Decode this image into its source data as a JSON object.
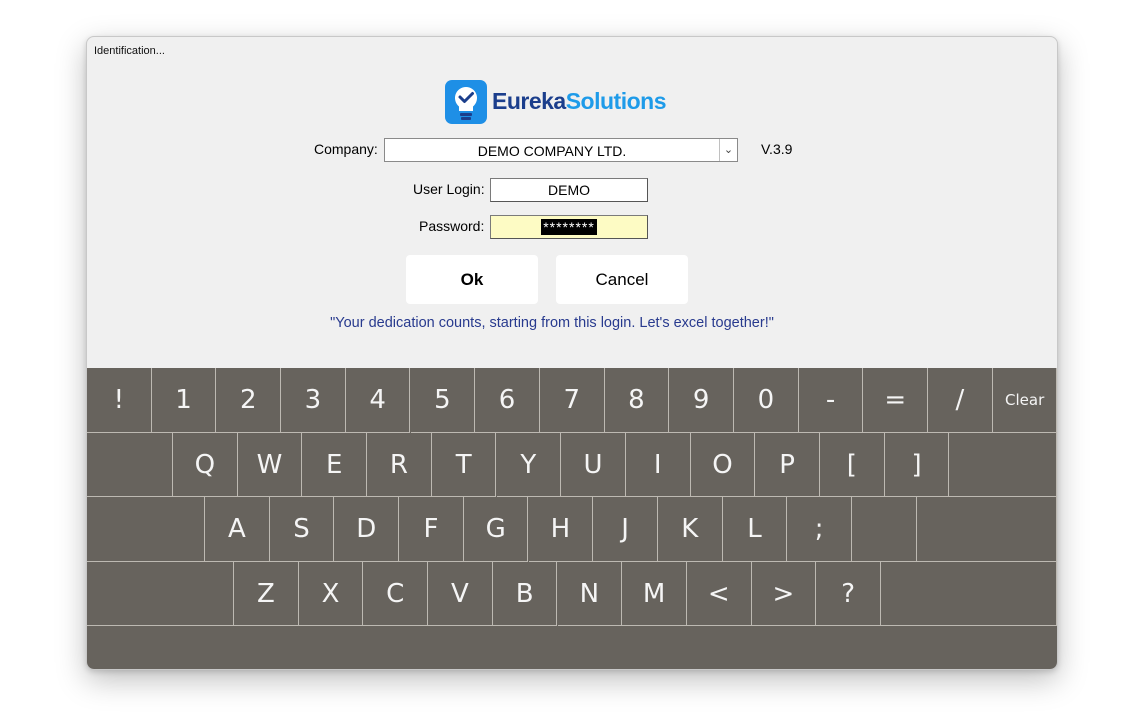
{
  "window": {
    "title": "Identification..."
  },
  "logo": {
    "word1": "Eureka",
    "word2": "Solutions",
    "brand_dark": "#1b3e8c",
    "brand_light": "#1e9be9"
  },
  "form": {
    "company_label": "Company:",
    "company_value": "DEMO COMPANY LTD.",
    "version": "V.3.9",
    "user_label": "User Login:",
    "user_value": "DEMO",
    "password_label": "Password:",
    "password_mask": "********"
  },
  "buttons": {
    "ok": "Ok",
    "cancel": "Cancel"
  },
  "motto": "\"Your dedication counts, starting from this login. Let's excel together!\"",
  "keyboard": {
    "row1": [
      "!",
      "1",
      "2",
      "3",
      "4",
      "5",
      "6",
      "7",
      "8",
      "9",
      "0",
      "-",
      "=",
      "/",
      "Clear"
    ],
    "row2": [
      "Q",
      "W",
      "E",
      "R",
      "T",
      "Y",
      "U",
      "I",
      "O",
      "P",
      "[",
      "]"
    ],
    "row3": [
      "A",
      "S",
      "D",
      "F",
      "G",
      "H",
      "J",
      "K",
      "L",
      ";"
    ],
    "row4": [
      "Z",
      "X",
      "C",
      "V",
      "B",
      "N",
      "M",
      "<",
      ">",
      "?"
    ]
  },
  "colors": {
    "keyboard_bg": "#67635d",
    "password_bg": "#fdfbc4",
    "motto": "#283a8e"
  }
}
